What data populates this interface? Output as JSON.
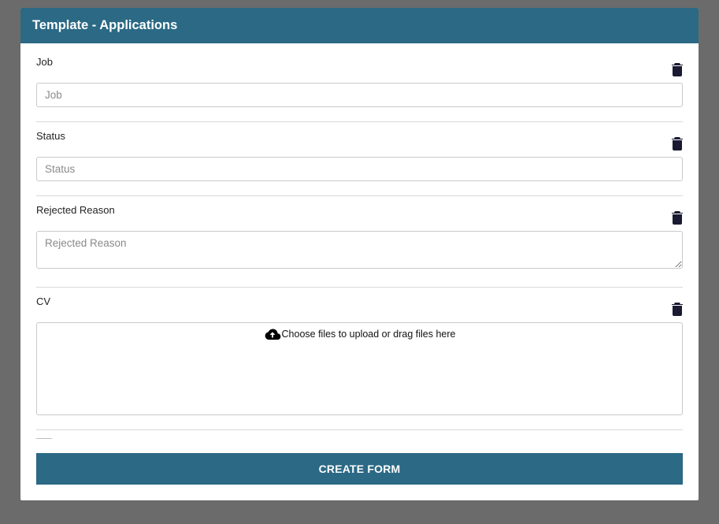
{
  "header": {
    "title": "Template - Applications"
  },
  "fields": {
    "job": {
      "label": "Job",
      "placeholder": "Job"
    },
    "status": {
      "label": "Status",
      "placeholder": "Status"
    },
    "rejected_reason": {
      "label": "Rejected Reason",
      "placeholder": "Rejected Reason"
    },
    "cv": {
      "label": "CV",
      "dropzone_text": "Choose files to upload or drag files here"
    }
  },
  "actions": {
    "create_form": "CREATE FORM"
  }
}
